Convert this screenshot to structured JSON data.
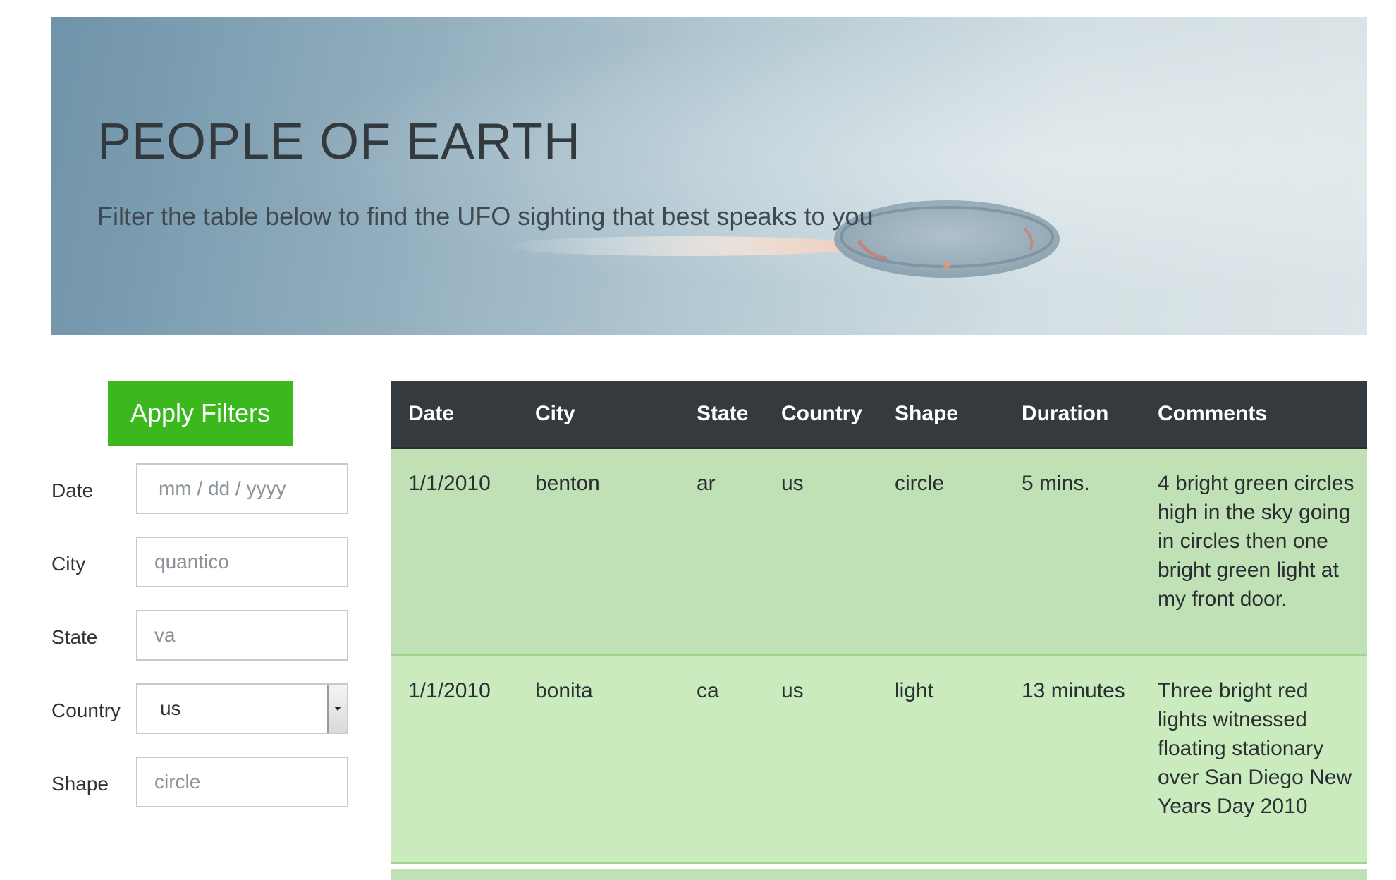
{
  "hero": {
    "title": "PEOPLE OF EARTH",
    "subtitle": "Filter the table below to find the UFO sighting that best speaks to you"
  },
  "filters": {
    "apply_label": "Apply Filters",
    "date": {
      "label": "Date",
      "placeholder": "mm / dd / yyyy"
    },
    "city": {
      "label": "City",
      "placeholder": "quantico"
    },
    "state": {
      "label": "State",
      "placeholder": "va"
    },
    "country": {
      "label": "Country",
      "selected": "us"
    },
    "shape": {
      "label": "Shape",
      "placeholder": "circle"
    }
  },
  "table": {
    "columns": [
      "Date",
      "City",
      "State",
      "Country",
      "Shape",
      "Duration",
      "Comments"
    ],
    "rows": [
      [
        "1/1/2010",
        "benton",
        "ar",
        "us",
        "circle",
        "5 mins.",
        "4 bright green circles high in the sky going in circles then one bright green light at my front door."
      ],
      [
        "1/1/2010",
        "bonita",
        "ca",
        "us",
        "light",
        "13 minutes",
        "Three bright red lights witnessed floating stationary over San Diego New Years Day 2010"
      ]
    ]
  },
  "colors": {
    "apply_button": "#3cb81f",
    "table_header": "#353a3e",
    "row_odd": "#bfe1b5",
    "row_even": "#c9ebbd"
  }
}
